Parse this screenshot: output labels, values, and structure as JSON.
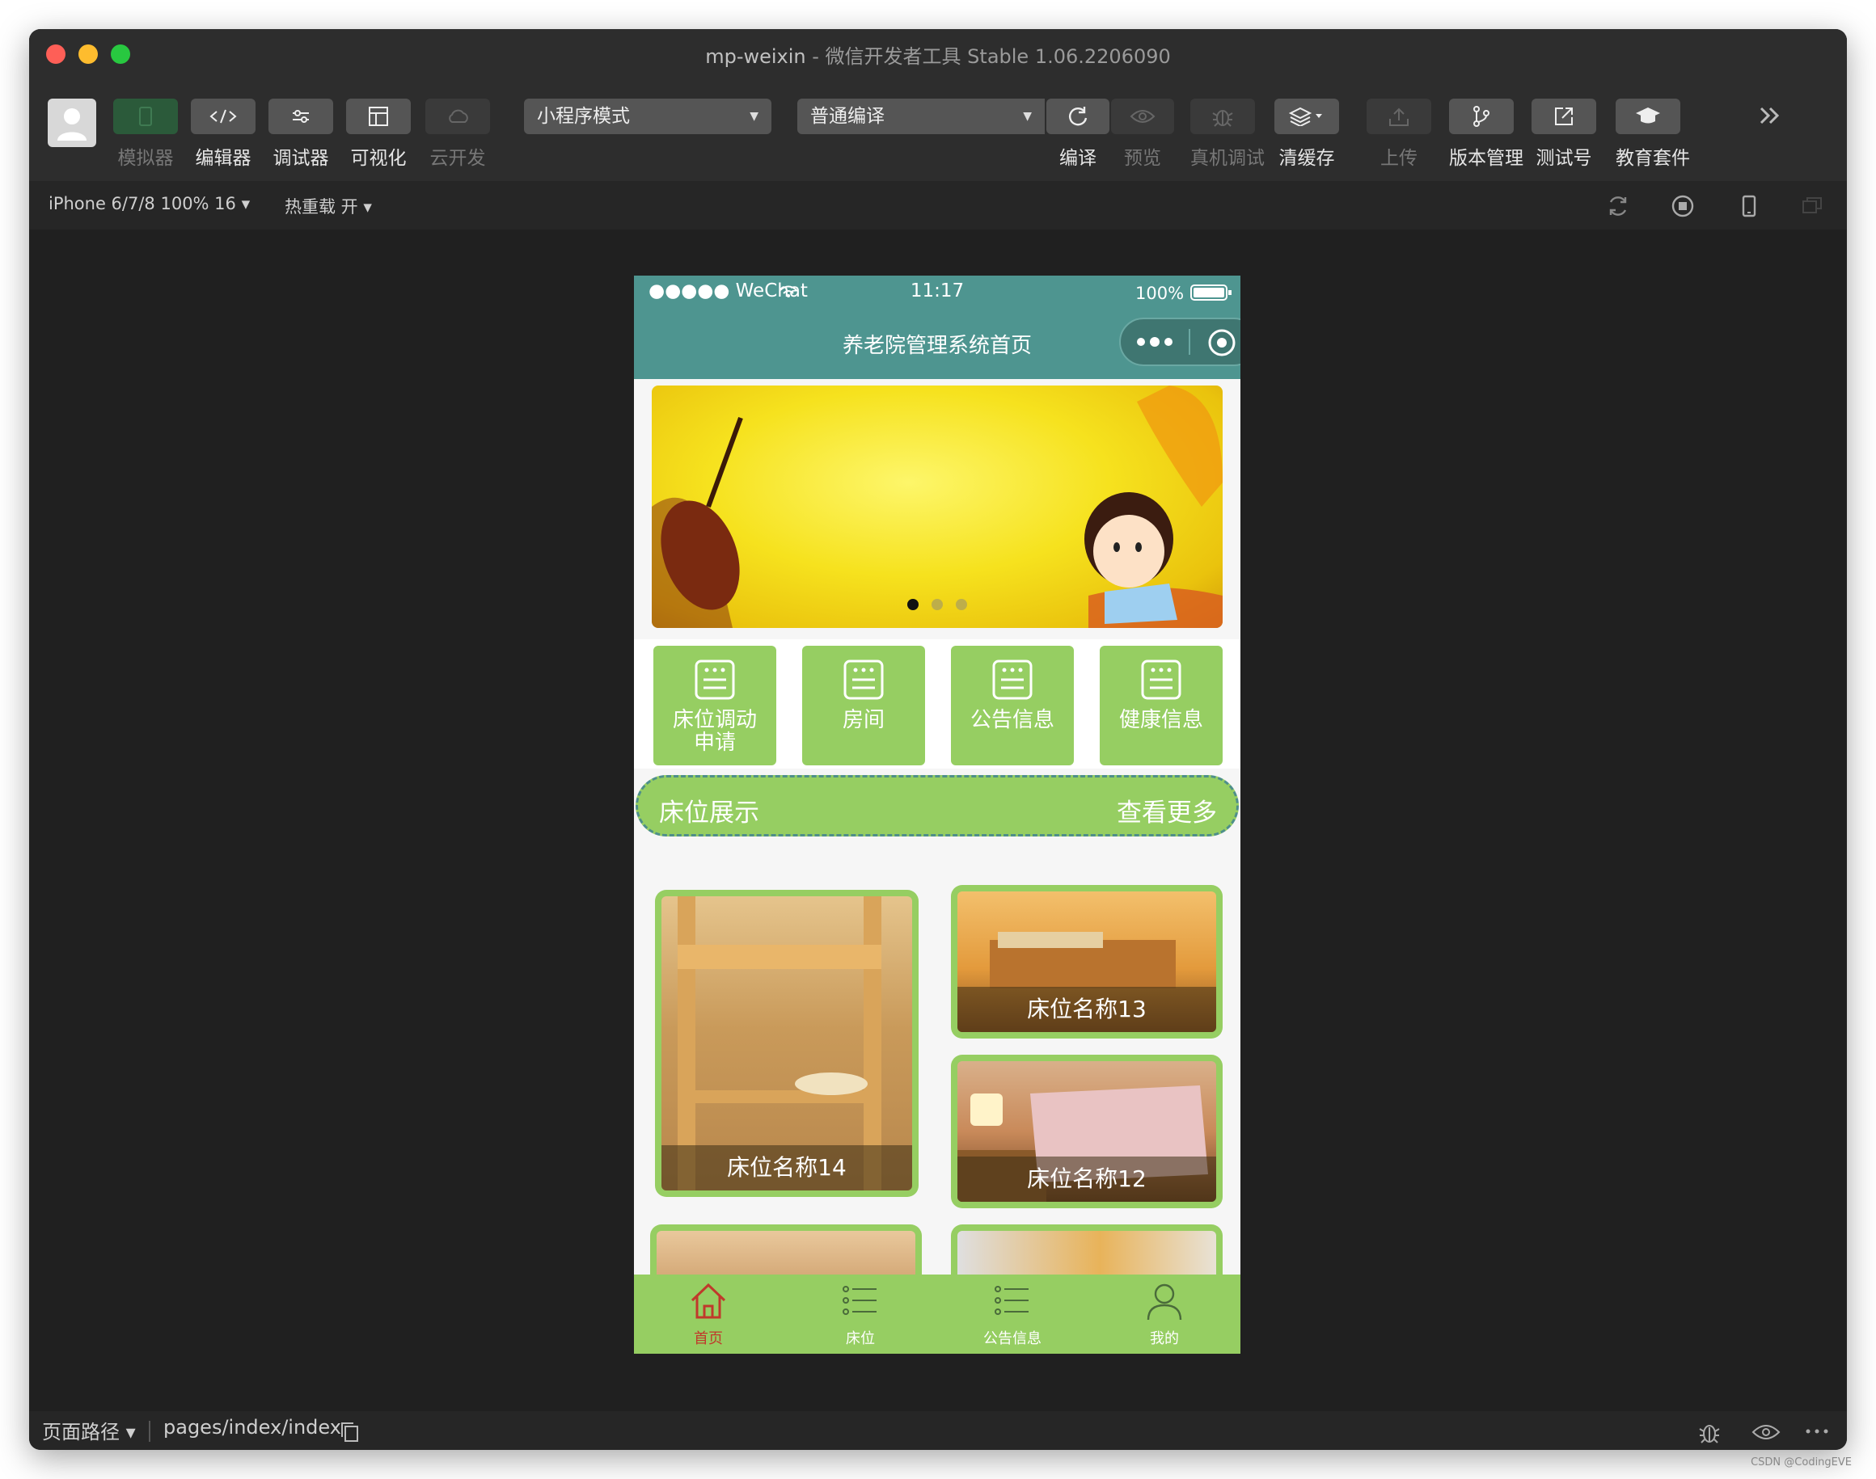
{
  "window": {
    "app_name": "mp-weixin",
    "separator": " - ",
    "tool_name": "微信开发者工具 Stable 1.06.2206090"
  },
  "toolbar": {
    "left_tools": [
      {
        "label": "模拟器",
        "icon": "phone-icon"
      },
      {
        "label": "编辑器",
        "icon": "code-icon"
      },
      {
        "label": "调试器",
        "icon": "debug-sliders-icon"
      },
      {
        "label": "可视化",
        "icon": "layout-icon"
      },
      {
        "label": "云开发",
        "icon": "cloud-icon"
      }
    ],
    "mode_select": "小程序模式",
    "compile_select": "普通编译",
    "right_tools": [
      {
        "label": "编译",
        "icon": "refresh-icon"
      },
      {
        "label": "预览",
        "icon": "eye-icon"
      },
      {
        "label": "真机调试",
        "icon": "bug-icon"
      },
      {
        "label": "清缓存",
        "icon": "layers-icon"
      },
      {
        "label": "上传",
        "icon": "upload-icon"
      },
      {
        "label": "版本管理",
        "icon": "branch-icon"
      },
      {
        "label": "测试号",
        "icon": "external-link-icon"
      },
      {
        "label": "教育套件",
        "icon": "graduation-cap-icon"
      }
    ]
  },
  "subbar": {
    "device": "iPhone 6/7/8 100% 16",
    "hot_reload": "热重载 开"
  },
  "phone": {
    "status": {
      "carrier": "●●●●● WeChat",
      "time": "11:17",
      "battery": "100%"
    },
    "nav_title": "养老院管理系统首页",
    "banner_dots": 3,
    "menu": [
      {
        "label": "床位调动申请"
      },
      {
        "label": "房间"
      },
      {
        "label": "公告信息"
      },
      {
        "label": "健康信息"
      }
    ],
    "section": {
      "title": "床位展示",
      "more": "查看更多"
    },
    "beds": [
      {
        "name": "床位名称14"
      },
      {
        "name": "床位名称13"
      },
      {
        "name": "床位名称12"
      }
    ],
    "tabs": [
      {
        "label": "首页",
        "icon": "home-icon"
      },
      {
        "label": "床位",
        "icon": "list-icon"
      },
      {
        "label": "公告信息",
        "icon": "list-icon"
      },
      {
        "label": "我的",
        "icon": "user-icon"
      }
    ]
  },
  "bottombar": {
    "path_label": "页面路径",
    "path_value": "pages/index/index"
  },
  "watermark": "CSDN @CodingEVE"
}
